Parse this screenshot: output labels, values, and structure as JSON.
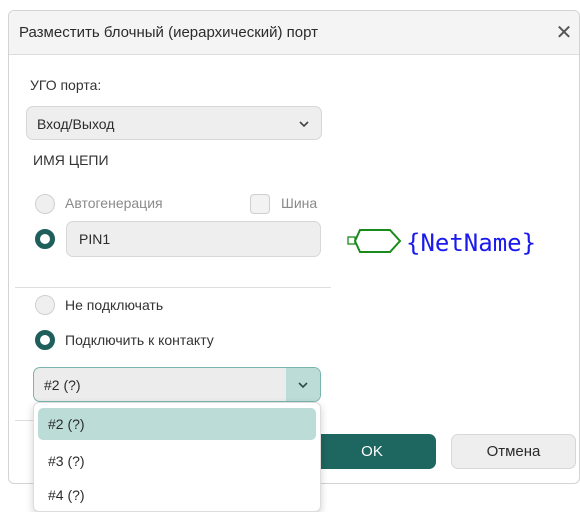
{
  "dialog": {
    "title": "Разместить блочный (иерархический) порт",
    "close_icon": "close-icon"
  },
  "port_symbol": {
    "label": "УГО порта:",
    "selected": "Вход/Выход"
  },
  "net_name": {
    "section_label": "ИМЯ ЦЕПИ",
    "autogen_label": "Автогенерация",
    "autogen_checked": false,
    "bus_label": "Шина",
    "bus_checked": false,
    "manual_checked": true,
    "value": "PIN1"
  },
  "connection": {
    "no_connect_label": "Не подключать",
    "no_connect_checked": false,
    "connect_pin_label": "Подключить к контакту",
    "connect_pin_checked": true,
    "pin_selected": "#2 (?)",
    "pin_options": [
      "#2 (?)",
      "#3 (?)",
      "#4 (?)"
    ]
  },
  "preview": {
    "text": "{NetName}",
    "symbol_color": "#1a8a1a",
    "text_color": "#1a1aee"
  },
  "buttons": {
    "ok_label": "OK",
    "cancel_label": "Отмена"
  },
  "colors": {
    "accent": "#1e6660",
    "accent_light": "#bcdcd8"
  }
}
